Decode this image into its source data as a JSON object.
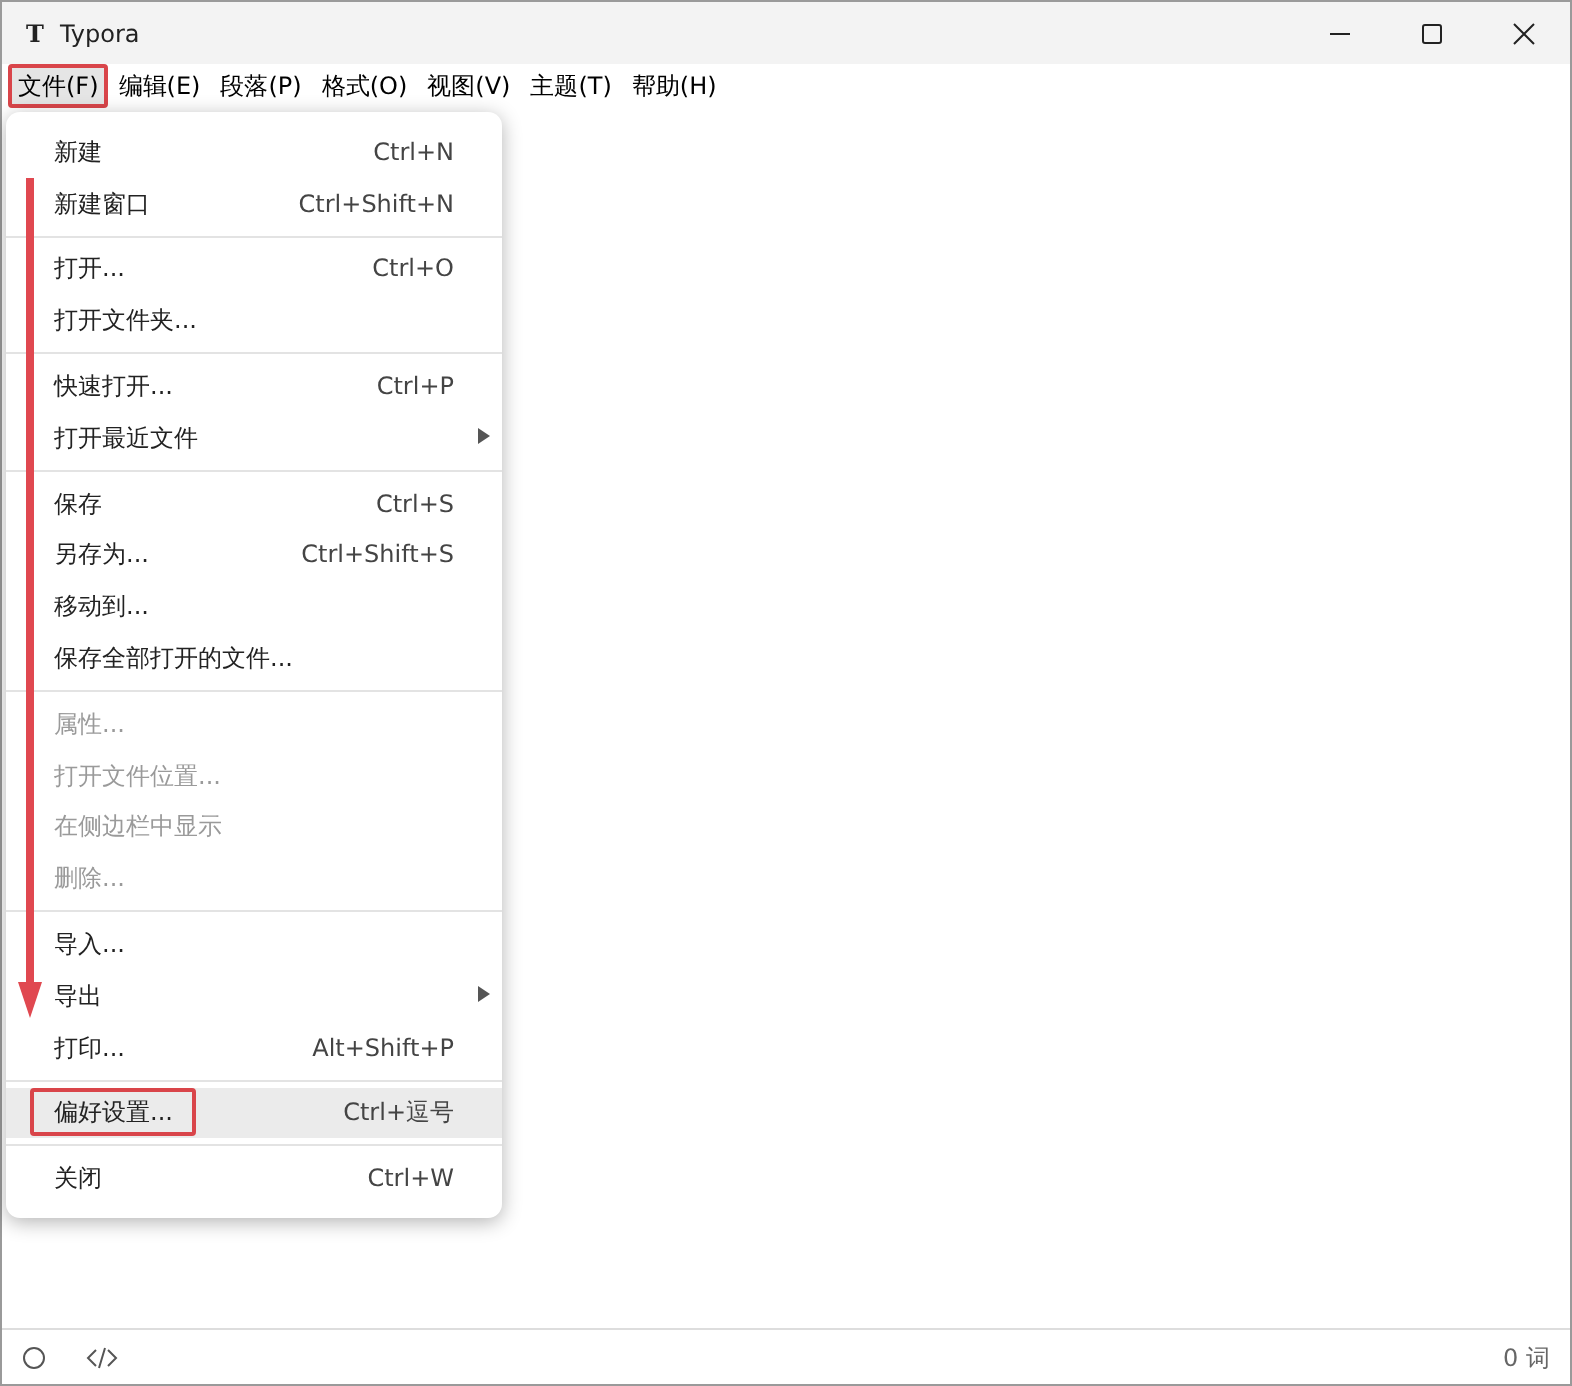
{
  "window": {
    "title": "Typora",
    "logo": "T"
  },
  "menubar": [
    {
      "label": "文件(F)",
      "selected": true,
      "marked": true
    },
    {
      "label": "编辑(E)",
      "selected": false,
      "marked": false
    },
    {
      "label": "段落(P)",
      "selected": false,
      "marked": false
    },
    {
      "label": "格式(O)",
      "selected": false,
      "marked": false
    },
    {
      "label": "视图(V)",
      "selected": false,
      "marked": false
    },
    {
      "label": "主题(T)",
      "selected": false,
      "marked": false
    },
    {
      "label": "帮助(H)",
      "selected": false,
      "marked": false
    }
  ],
  "menu": [
    {
      "items": [
        {
          "label": "新建",
          "shortcut": "Ctrl+N",
          "disabled": false,
          "selected": false,
          "marked": false,
          "submenu": false
        },
        {
          "label": "新建窗口",
          "shortcut": "Ctrl+Shift+N",
          "disabled": false,
          "selected": false,
          "marked": false,
          "submenu": false
        }
      ]
    },
    {
      "items": [
        {
          "label": "打开...",
          "shortcut": "Ctrl+O",
          "disabled": false,
          "selected": false,
          "marked": false,
          "submenu": false
        },
        {
          "label": "打开文件夹...",
          "disabled": false,
          "selected": false,
          "marked": false,
          "submenu": false
        }
      ]
    },
    {
      "items": [
        {
          "label": "快速打开...",
          "shortcut": "Ctrl+P",
          "disabled": false,
          "selected": false,
          "marked": false,
          "submenu": false
        },
        {
          "label": "打开最近文件",
          "disabled": false,
          "selected": false,
          "marked": false,
          "submenu": true
        }
      ]
    },
    {
      "items": [
        {
          "label": "保存",
          "shortcut": "Ctrl+S",
          "disabled": false,
          "selected": false,
          "marked": false,
          "submenu": false
        },
        {
          "label": "另存为...",
          "shortcut": "Ctrl+Shift+S",
          "disabled": false,
          "selected": false,
          "marked": false,
          "submenu": false
        },
        {
          "label": "移动到...",
          "disabled": false,
          "selected": false,
          "marked": false,
          "submenu": false
        },
        {
          "label": "保存全部打开的文件...",
          "disabled": false,
          "selected": false,
          "marked": false,
          "submenu": false
        }
      ]
    },
    {
      "items": [
        {
          "label": "属性...",
          "disabled": true,
          "selected": false,
          "marked": false,
          "submenu": false
        },
        {
          "label": "打开文件位置...",
          "disabled": true,
          "selected": false,
          "marked": false,
          "submenu": false
        },
        {
          "label": "在侧边栏中显示",
          "disabled": true,
          "selected": false,
          "marked": false,
          "submenu": false
        },
        {
          "label": "删除...",
          "disabled": true,
          "selected": false,
          "marked": false,
          "submenu": false
        }
      ]
    },
    {
      "items": [
        {
          "label": "导入...",
          "disabled": false,
          "selected": false,
          "marked": false,
          "submenu": false
        },
        {
          "label": "导出",
          "disabled": false,
          "selected": false,
          "marked": false,
          "submenu": true
        },
        {
          "label": "打印...",
          "shortcut": "Alt+Shift+P",
          "disabled": false,
          "selected": false,
          "marked": false,
          "submenu": false
        }
      ]
    },
    {
      "items": [
        {
          "label": "偏好设置...",
          "shortcut": "Ctrl+逗号",
          "disabled": false,
          "selected": true,
          "marked": true,
          "submenu": false
        }
      ]
    },
    {
      "items": [
        {
          "label": "关闭",
          "shortcut": "Ctrl+W",
          "disabled": false,
          "selected": false,
          "marked": false,
          "submenu": false
        }
      ]
    }
  ],
  "annotations": [
    {
      "kind": "arrow"
    }
  ],
  "status_bar": {
    "word_count": "0 词"
  }
}
